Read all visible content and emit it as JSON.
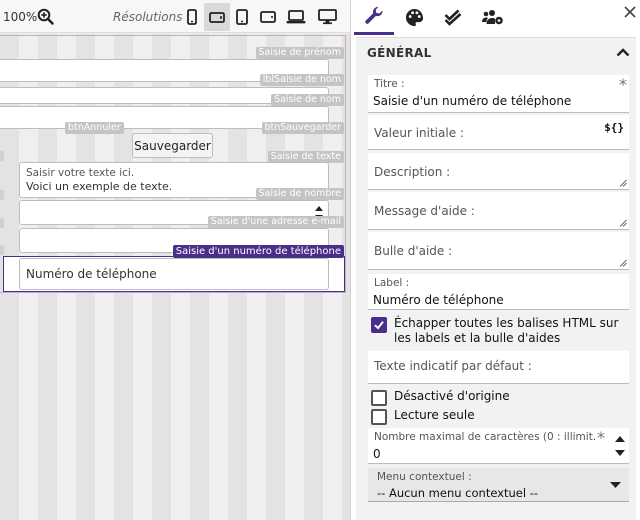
{
  "toolbar": {
    "zoom": "100%",
    "resolutions_label": "Résolutions :",
    "devices": [
      "phone-portrait-icon",
      "phone-landscape-icon",
      "tablet-portrait-icon",
      "tablet-landscape-icon",
      "laptop-icon",
      "desktop-icon"
    ],
    "active_device": "phone-landscape-icon"
  },
  "canvas": {
    "captions": {
      "prenom": "Saisie de prénom",
      "lbl_nom": "lblSaisie de nom",
      "nom": "Saisie de nom",
      "btn_annuler": "btnAnnuler",
      "btn_sauvegarder": "btnSauvegarder",
      "texte": "Saisie de texte",
      "nombre": "Saisie de nombre",
      "email": "Saisie d'une adresse e-mail",
      "phone": "Saisie d'un numéro de téléphone"
    },
    "save_button": "Sauvegarder",
    "textarea_placeholder": "Saisir votre texte ici.",
    "textarea_value": "Voici un exemple de texte.",
    "phone_placeholder": "Numéro de téléphone"
  },
  "panel": {
    "tabs": [
      "wrench-icon",
      "palette-icon",
      "check-double-icon",
      "users-cog-icon"
    ],
    "section_title": "GÉNÉRAL",
    "fields": {
      "titre_label": "Titre :",
      "titre_value": "Saisie d'un numéro de téléphone",
      "valeur_initiale": "Valeur initiale :",
      "valeur_badge": "${}",
      "description": "Description :",
      "message_aide": "Message d'aide :",
      "bulle_aide": "Bulle d'aide :",
      "label_label": "Label :",
      "label_value": "Numéro de téléphone",
      "echapper": "Échapper toutes les balises HTML sur les labels et la bulle d'aides",
      "texte_indicatif": "Texte indicatif par défaut :",
      "desactive": "Désactivé d'origine",
      "lecture_seule": "Lecture seule",
      "max_chars_label": "Nombre maximal de caractères (0 : illimit...",
      "max_chars_value": "0",
      "menu_label": "Menu contextuel :",
      "menu_value": "-- Aucun menu contextuel --"
    },
    "echapper_checked": true,
    "desactive_checked": false,
    "lecture_seule_checked": false,
    "accent_color": "#4a2f8a"
  }
}
